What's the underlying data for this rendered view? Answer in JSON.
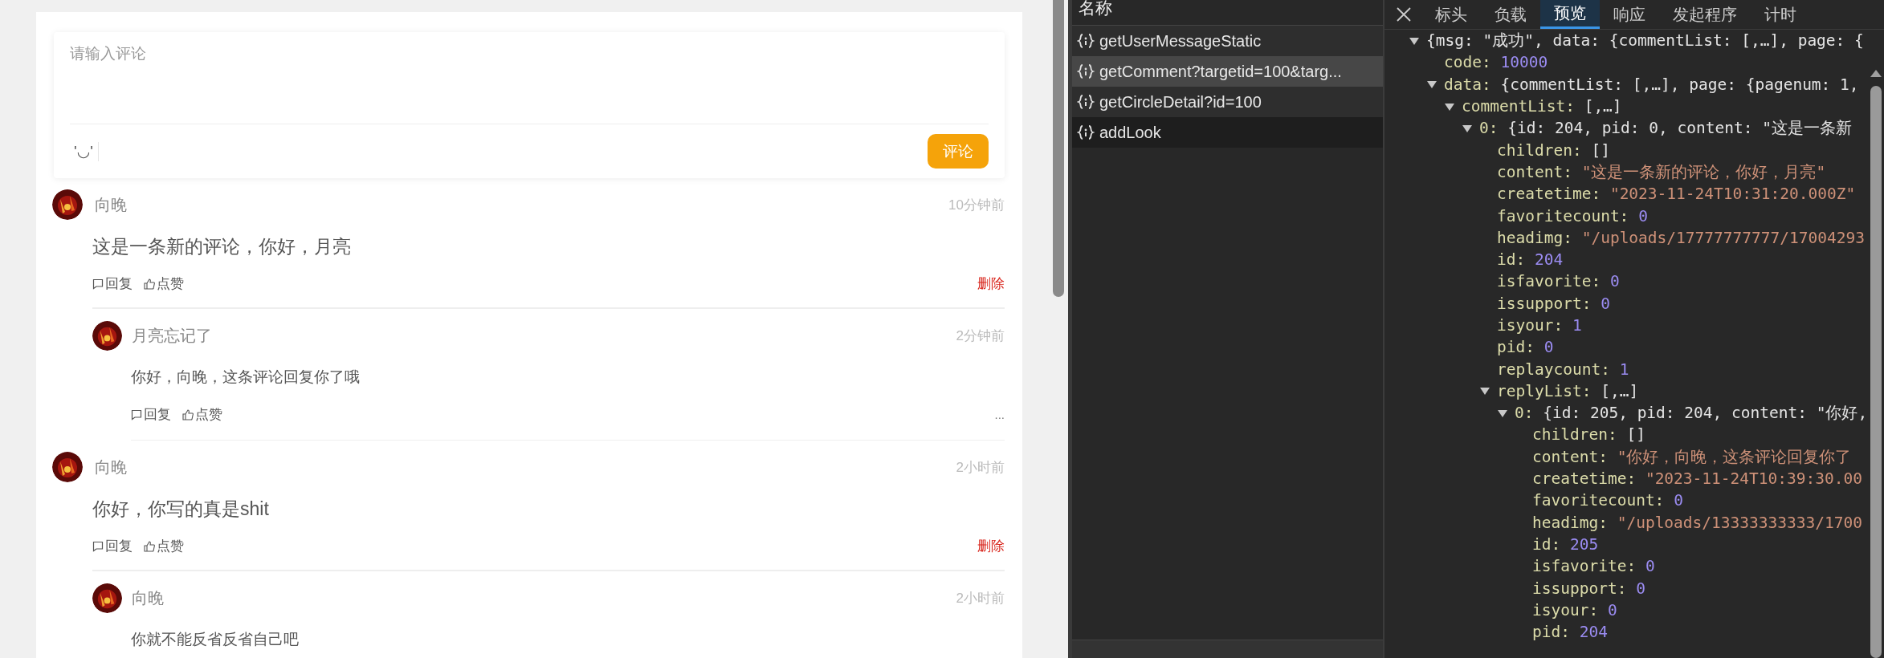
{
  "comment_box": {
    "placeholder": "请输入评论",
    "emoji": "'◡'",
    "submit_button": "评论"
  },
  "comments": [
    {
      "author": "向晚",
      "time": "10分钟前",
      "content": "这是一条新的评论，你好，月亮",
      "actions": [
        {
          "kind": "reply",
          "label": "回复"
        },
        {
          "kind": "like",
          "label": "点赞"
        }
      ],
      "menu": {
        "kind": "delete",
        "label": "删除"
      },
      "replies": [
        {
          "author": "月亮忘记了",
          "time": "2分钟前",
          "content": "你好，向晚，这条评论回复你了哦",
          "actions": [
            {
              "kind": "reply",
              "label": "回复"
            },
            {
              "kind": "like",
              "label": "点赞"
            }
          ],
          "menu": {
            "kind": "more",
            "label": "..."
          }
        }
      ]
    },
    {
      "author": "向晚",
      "time": "2小时前",
      "content": "你好，你写的真是shit",
      "actions": [
        {
          "kind": "reply",
          "label": "回复"
        },
        {
          "kind": "like",
          "label": "点赞"
        }
      ],
      "menu": {
        "kind": "delete",
        "label": "删除"
      },
      "replies": [
        {
          "author": "向晚",
          "time": "2小时前",
          "content": "你就不能反省反省自己吧"
        }
      ]
    }
  ],
  "network": {
    "header": "名称",
    "requests": [
      {
        "name": "getUserMessageStatic",
        "selected": false
      },
      {
        "name": "getComment?targetid=100&targ...",
        "selected": true
      },
      {
        "name": "getCircleDetail?id=100",
        "selected": false
      },
      {
        "name": "addLook",
        "selected": false
      }
    ]
  },
  "preview": {
    "tabs": [
      {
        "label": "标头",
        "selected": false
      },
      {
        "label": "负载",
        "selected": false
      },
      {
        "label": "预览",
        "selected": true
      },
      {
        "label": "响应",
        "selected": false
      },
      {
        "label": "发起程序",
        "selected": false
      },
      {
        "label": "计时",
        "selected": false
      }
    ],
    "tree": [
      {
        "value": "{msg: \"成功\", data: {commentList: [,…], page: {",
        "kind": "object",
        "expanded": true,
        "children": [
          {
            "key": "code:",
            "value": "10000",
            "kind": "number"
          },
          {
            "key": "data:",
            "value": "{commentList: [,…], page: {pagenum: 1,",
            "kind": "object",
            "expanded": true,
            "children": [
              {
                "key": "commentList:",
                "value": "[,…]",
                "kind": "object",
                "expanded": true,
                "children": [
                  {
                    "key": "0:",
                    "value": "{id: 204, pid: 0, content: \"这是一条新",
                    "kind": "object",
                    "expanded": true,
                    "children": [
                      {
                        "key": "children:",
                        "value": "[]",
                        "kind": "object"
                      },
                      {
                        "key": "content:",
                        "value": "\"这是一条新的评论，你好，月亮\"",
                        "kind": "string"
                      },
                      {
                        "key": "createtime:",
                        "value": "\"2023-11-24T10:31:20.000Z\"",
                        "kind": "string"
                      },
                      {
                        "key": "favoritecount:",
                        "value": "0",
                        "kind": "number"
                      },
                      {
                        "key": "headimg:",
                        "value": "\"/uploads/17777777777/17004293",
                        "kind": "string"
                      },
                      {
                        "key": "id:",
                        "value": "204",
                        "kind": "number"
                      },
                      {
                        "key": "isfavorite:",
                        "value": "0",
                        "kind": "number"
                      },
                      {
                        "key": "issupport:",
                        "value": "0",
                        "kind": "number"
                      },
                      {
                        "key": "isyour:",
                        "value": "1",
                        "kind": "number"
                      },
                      {
                        "key": "pid:",
                        "value": "0",
                        "kind": "number"
                      },
                      {
                        "key": "replaycount:",
                        "value": "1",
                        "kind": "number"
                      },
                      {
                        "key": "replyList:",
                        "value": "[,…]",
                        "kind": "object",
                        "expanded": true,
                        "children": [
                          {
                            "key": "0:",
                            "value": "{id: 205, pid: 204, content: \"你好,",
                            "kind": "object",
                            "expanded": true,
                            "children": [
                              {
                                "key": "children:",
                                "value": "[]",
                                "kind": "object"
                              },
                              {
                                "key": "content:",
                                "value": "\"你好，向晚，这条评论回复你了",
                                "kind": "string"
                              },
                              {
                                "key": "createtime:",
                                "value": "\"2023-11-24T10:39:30.00",
                                "kind": "string"
                              },
                              {
                                "key": "favoritecount:",
                                "value": "0",
                                "kind": "number"
                              },
                              {
                                "key": "headimg:",
                                "value": "\"/uploads/13333333333/1700",
                                "kind": "string"
                              },
                              {
                                "key": "id:",
                                "value": "205",
                                "kind": "number"
                              },
                              {
                                "key": "isfavorite:",
                                "value": "0",
                                "kind": "number"
                              },
                              {
                                "key": "issupport:",
                                "value": "0",
                                "kind": "number"
                              },
                              {
                                "key": "isyour:",
                                "value": "0",
                                "kind": "number"
                              },
                              {
                                "key": "pid:",
                                "value": "204",
                                "kind": "number"
                              }
                            ]
                          }
                        ]
                      }
                    ]
                  }
                ]
              }
            ]
          }
        ]
      }
    ]
  }
}
